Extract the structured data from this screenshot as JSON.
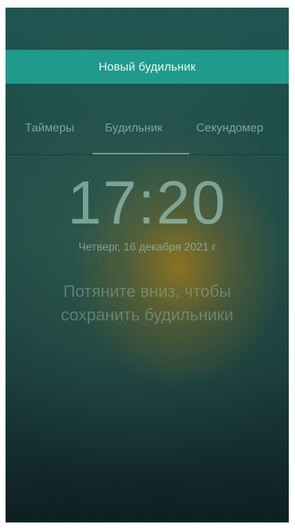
{
  "header": {
    "new_alarm_label": "Новый будильник"
  },
  "tabs": [
    {
      "label": "Таймеры",
      "active": false
    },
    {
      "label": "Будильник",
      "active": true
    },
    {
      "label": "Секундомер",
      "active": false
    }
  ],
  "clock": {
    "time": "17:20",
    "date": "Четверг, 16 декабря 2021 г"
  },
  "hint": {
    "line1": "Потяните вниз, чтобы",
    "line2": "сохранить будильники"
  },
  "colors": {
    "accent": "#1f9c8c",
    "background_top": "#1f5552",
    "background_bottom": "#0c1e1f",
    "glow": "#a67a16"
  }
}
